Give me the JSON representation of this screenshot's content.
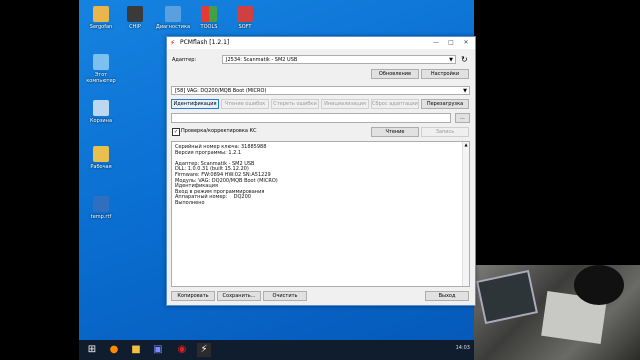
{
  "desktop": {
    "icons": [
      {
        "label": "Sergofan",
        "color": "#e8b64a"
      },
      {
        "label": "CHIP",
        "color": "#3a3a3a"
      },
      {
        "label": "Диагностика",
        "color": "#5aa0e0"
      },
      {
        "label": "TOOLS",
        "color": "#e0a020"
      },
      {
        "label": "SOFT",
        "color": "#d04040"
      },
      {
        "label": "Этот компьютер",
        "color": "#7cc0f0"
      },
      {
        "label": "Корзина",
        "color": "#bcd8f0"
      },
      {
        "label": "Рабочая",
        "color": "#e8c050"
      },
      {
        "label": "temp.rtf",
        "color": "#2f6fc0"
      }
    ]
  },
  "window": {
    "title": "PCMflash [1.2.1]",
    "adapter_label": "Адаптер:",
    "adapter_value": "J2534: Scanmatik - SM2 USB",
    "update_button": "Обновление",
    "settings_button": "Настройки",
    "module_value": "[58] VAG: DQ200/MQB Boot (MICRO)",
    "tabs": [
      "Идентификация",
      "Чтение ошибок",
      "Стереть ошибки",
      "Инициализация",
      "Сброс адаптации",
      "Перезагрузка"
    ],
    "browse_button": "...",
    "checksum_label": "Проверка/корректировка КС",
    "read_button": "Чтение",
    "write_button": "Запись",
    "log": [
      "Серийный номер ключа: 31885988",
      "Версия программы: 1.2.1",
      "",
      "Адаптер: Scanmatik - SM2 USB",
      "DLL: 1.0.0.31 (built 15.12.20)",
      "Firmware: FW:0894 HW:02 SN:A51229",
      "Модуль: VAG: DQ200/MQB Boot (MICRO)",
      "Идентификация",
      "Вход в режим программирования",
      "Аппаратный номер:    DQ200",
      "Выполнено"
    ],
    "copy_button": "Копировать",
    "save_button": "Сохранить...",
    "clear_button": "Очистить",
    "exit_button": "Выход"
  },
  "taskbar": {
    "time": "14:03"
  }
}
